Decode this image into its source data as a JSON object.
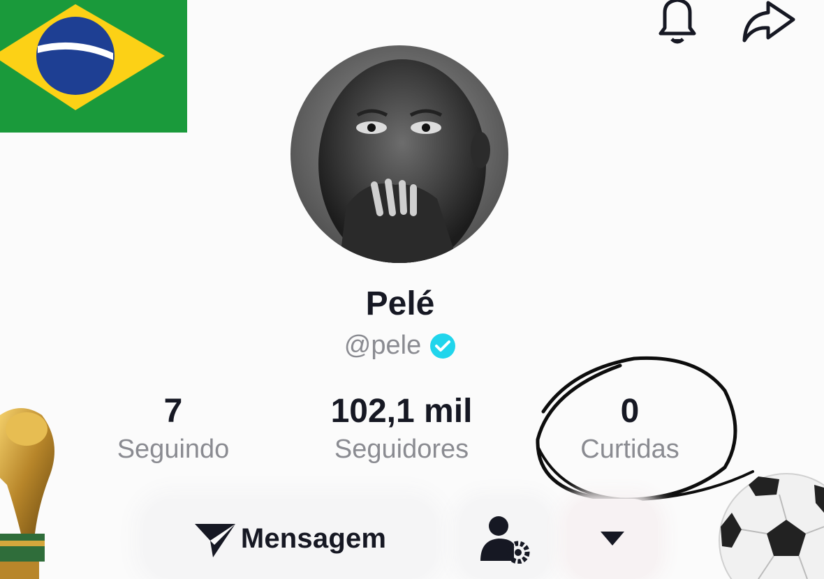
{
  "profile": {
    "name": "Pelé",
    "handle": "@pele",
    "verified": true
  },
  "stats": [
    {
      "value": "7",
      "label": "Seguindo"
    },
    {
      "value": "102,1 mil",
      "label": "Seguidores"
    },
    {
      "value": "0",
      "label": "Curtidas"
    }
  ],
  "actions": {
    "message_label": "Mensagem"
  },
  "icons": {
    "top_bar": [
      "bell-icon",
      "share-icon"
    ],
    "message": "send-icon",
    "add_friend": "user-settings-icon",
    "more": "dropdown-triangle-icon"
  },
  "stickers": [
    "brazil-flag",
    "world-cup-trophy",
    "soccer-ball"
  ],
  "annotation": "hand-drawn circle around Curtidas",
  "colors": {
    "text": "#161823",
    "muted": "#8a8b91",
    "verified": "#20d5ec",
    "flag_green": "#1a9a3b",
    "flag_yellow": "#fcd116",
    "flag_blue": "#1e3f93"
  }
}
